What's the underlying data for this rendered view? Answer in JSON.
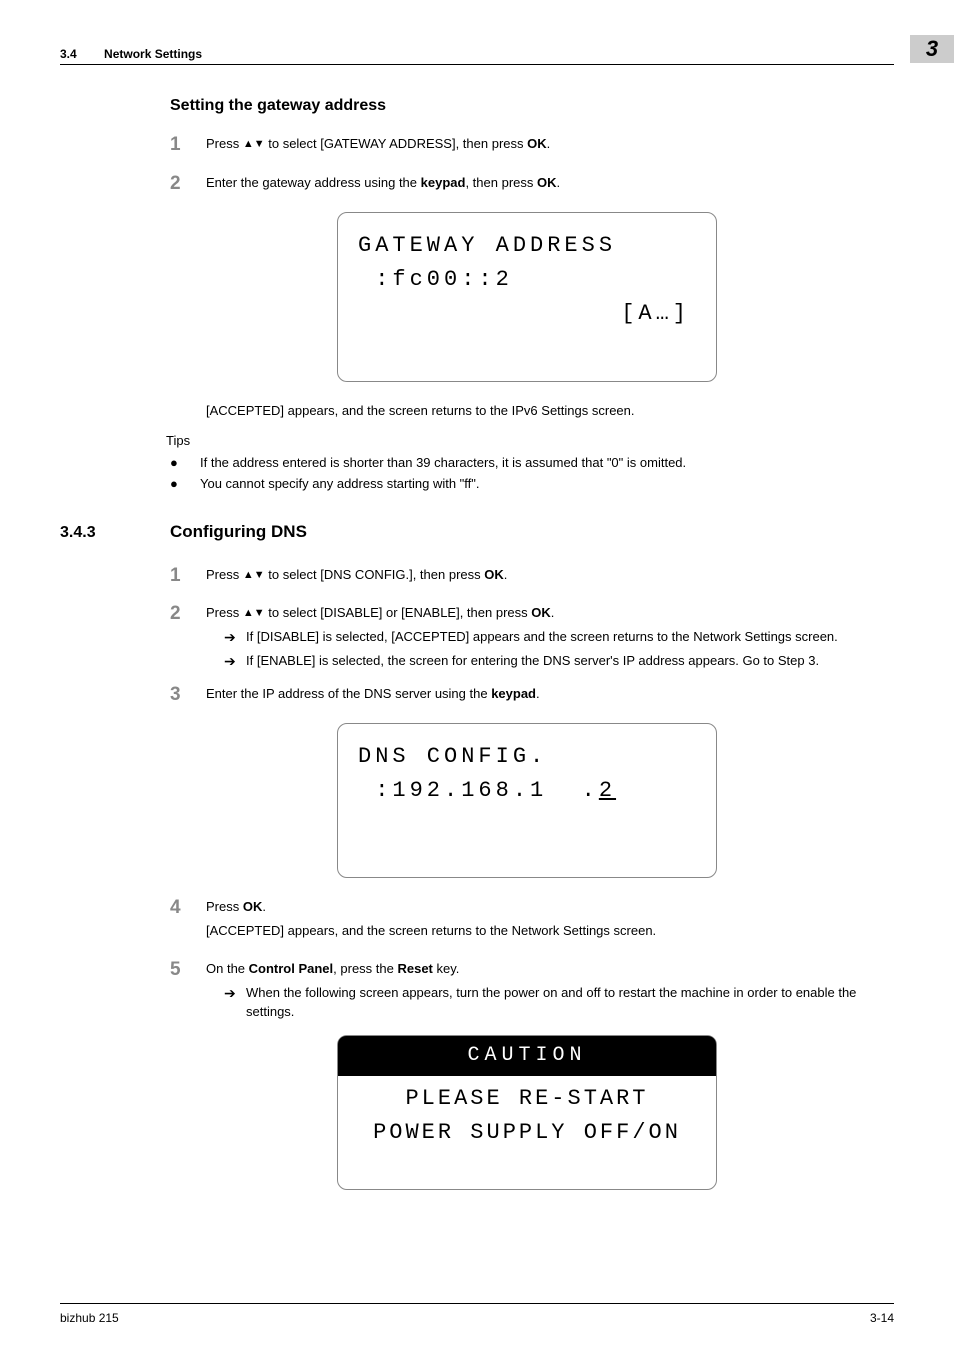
{
  "header": {
    "section_number": "3.4",
    "section_title": "Network Settings",
    "chapter_number": "3"
  },
  "s1": {
    "title": "Setting the gateway address",
    "step1_pre": "Press ",
    "step1_post": " to select [GATEWAY ADDRESS], then press ",
    "step1_ok": "OK",
    "step1_end": ".",
    "step2_pre": "Enter the gateway address using the ",
    "step2_key": "keypad",
    "step2_mid": ", then press ",
    "step2_ok": "OK",
    "step2_end": ".",
    "lcd1_l1": "GATEWAY ADDRESS",
    "lcd1_l2": " :fc00::2",
    "lcd1_l3": "[A…]",
    "result": "[ACCEPTED] appears, and the screen returns to the IPv6 Settings screen.",
    "tips_label": "Tips",
    "tip1": "If the address entered is shorter than 39 characters, it is assumed that \"0\" is omitted.",
    "tip2": "You cannot specify any address starting with \"ff\"."
  },
  "s2": {
    "num": "3.4.3",
    "title": "Configuring DNS",
    "step1_pre": "Press ",
    "step1_post": " to select [DNS CONFIG.], then press ",
    "step1_ok": "OK",
    "step1_end": ".",
    "step2_pre": "Press ",
    "step2_post": " to select [DISABLE] or [ENABLE], then press ",
    "step2_ok": "OK",
    "step2_end": ".",
    "step2_sub1": "If [DISABLE] is selected, [ACCEPTED] appears and the screen returns to the Network Settings screen.",
    "step2_sub2": "If [ENABLE] is selected, the screen for entering the DNS server's IP address appears. Go to Step 3.",
    "step3_pre": "Enter the IP address of the DNS server using the ",
    "step3_key": "keypad",
    "step3_end": ".",
    "lcd2_l1": "DNS CONFIG.",
    "lcd2_l2a": " :192.168.1  .",
    "lcd2_l2b": "2",
    "step4_pre": "Press ",
    "step4_ok": "OK",
    "step4_end": ".",
    "step4_result": "[ACCEPTED] appears, and the screen returns to the Network Settings screen.",
    "step5_pre": "On the ",
    "step5_cp": "Control Panel",
    "step5_mid": ", press the ",
    "step5_reset": "Reset",
    "step5_end": " key.",
    "step5_sub": "When the following screen appears, turn the power on and off to restart the machine in order to enable the settings.",
    "lcd3_header": "CAUTION",
    "lcd3_l1": "PLEASE RE-START",
    "lcd3_l2": "POWER SUPPLY OFF/ON"
  },
  "footer": {
    "left": "bizhub 215",
    "right": "3-14"
  },
  "chart_data": null
}
